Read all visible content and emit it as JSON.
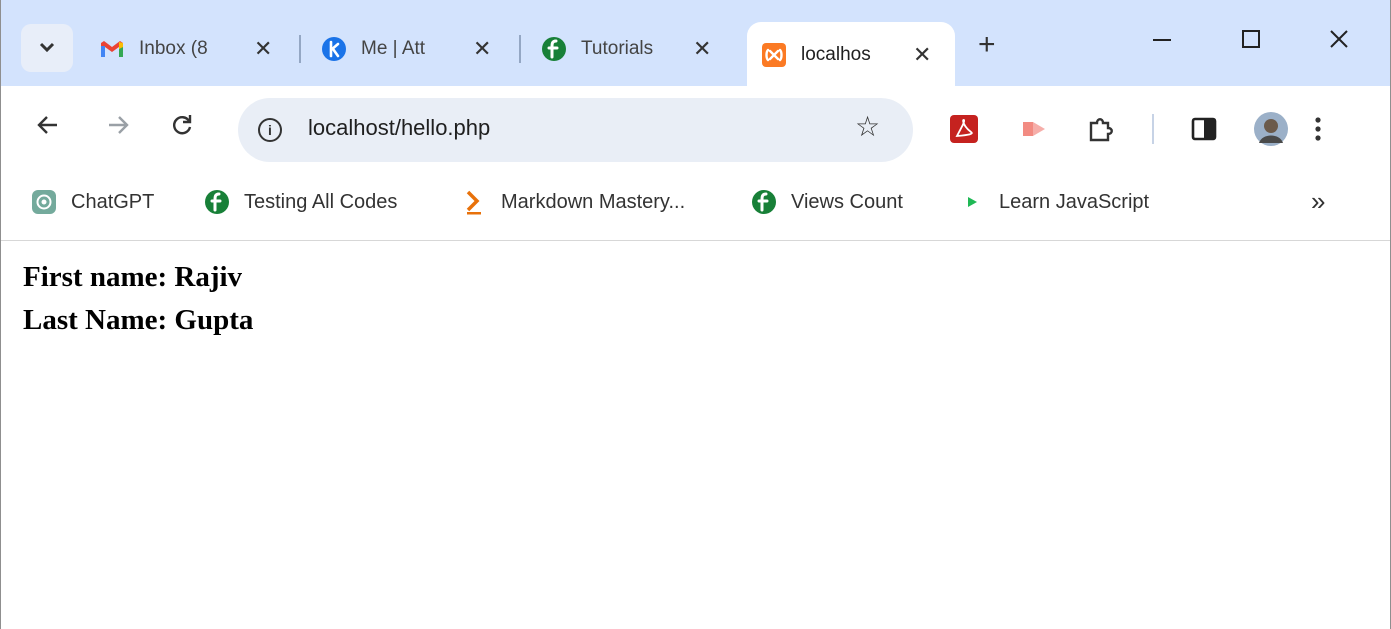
{
  "tabs": [
    {
      "title": "Inbox (8",
      "icon": "gmail-icon"
    },
    {
      "title": "Me | Att",
      "icon": "k-blue-icon"
    },
    {
      "title": "Tutorials",
      "icon": "green-f-icon"
    },
    {
      "title": "localhos",
      "icon": "xampp-icon",
      "active": true
    }
  ],
  "address": {
    "url": "localhost/hello.php"
  },
  "bookmarks": [
    {
      "label": "ChatGPT",
      "icon": "chatgpt-icon"
    },
    {
      "label": "Testing All Codes",
      "icon": "green-f-icon"
    },
    {
      "label": "Markdown Mastery...",
      "icon": "orange-chevron-icon"
    },
    {
      "label": "Views Count",
      "icon": "green-f-icon"
    },
    {
      "label": "Learn JavaScript",
      "icon": "green-play-icon"
    }
  ],
  "page": {
    "first_name_line": "First name: Rajiv",
    "last_name_line": "Last Name: Gupta"
  },
  "colors": {
    "tabstrip": "#d3e3fd",
    "omnibox": "#e9eef6",
    "green_icon": "#188038",
    "gmail_red": "#ea4335",
    "xampp_orange": "#fb7a24",
    "pdf_red": "#c5221f"
  }
}
